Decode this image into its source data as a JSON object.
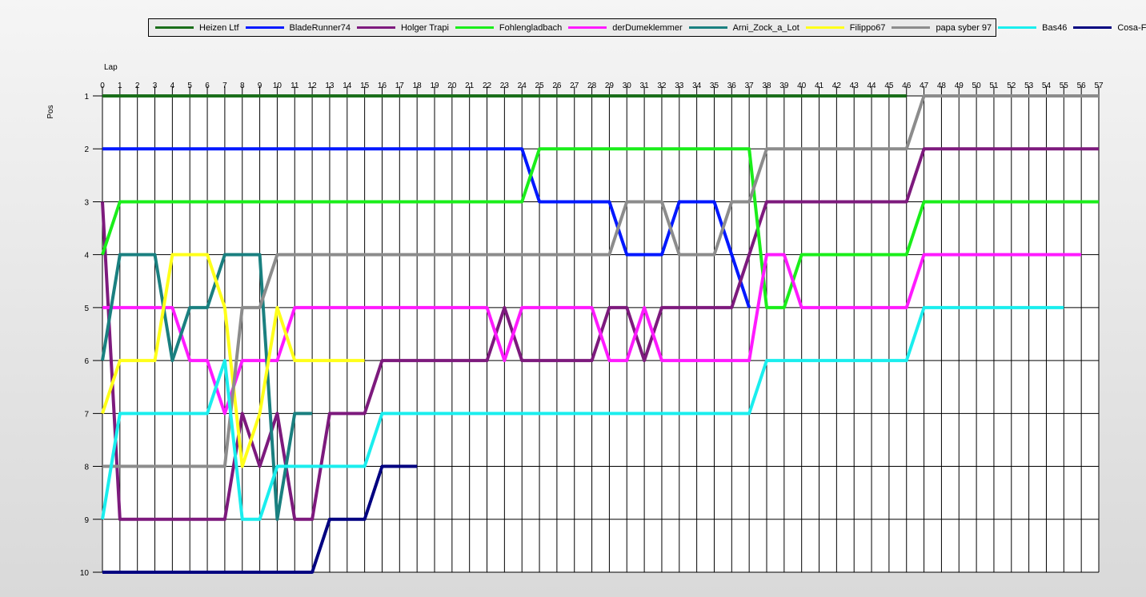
{
  "chart_data": {
    "type": "line",
    "xlabel": "Lap",
    "ylabel": "Pos",
    "xlim": [
      0,
      57
    ],
    "ylim": [
      1,
      10
    ],
    "y_inverted": true,
    "grid": true,
    "legend_position": "top",
    "x_ticks": [
      "0",
      "1",
      "2",
      "3",
      "4",
      "5",
      "6",
      "7",
      "8",
      "9",
      "10",
      "11",
      "12",
      "13",
      "14",
      "15",
      "16",
      "17",
      "18",
      "19",
      "20",
      "21",
      "22",
      "23",
      "24",
      "25",
      "26",
      "27",
      "28",
      "29",
      "30",
      "31",
      "32",
      "33",
      "34",
      "35",
      "36",
      "37",
      "38",
      "39",
      "40",
      "41",
      "42",
      "43",
      "44",
      "45",
      "46",
      "47",
      "48",
      "49",
      "50",
      "51",
      "52",
      "53",
      "54",
      "55",
      "56",
      "57"
    ],
    "y_ticks": [
      "1",
      "2",
      "3",
      "4",
      "5",
      "6",
      "7",
      "8",
      "9",
      "10"
    ],
    "series": [
      {
        "name": "Heizen Ltf",
        "color": "#1a6e1a",
        "points": [
          [
            0,
            1
          ],
          [
            46,
            1
          ]
        ]
      },
      {
        "name": "BladeRunner74",
        "color": "#0018ff",
        "points": [
          [
            0,
            2
          ],
          [
            24,
            2
          ],
          [
            25,
            3
          ],
          [
            29,
            3
          ],
          [
            30,
            4
          ],
          [
            32,
            4
          ],
          [
            33,
            3
          ],
          [
            35,
            3
          ],
          [
            37,
            5
          ]
        ]
      },
      {
        "name": "Holger Trapi",
        "color": "#7d1a7d",
        "points": [
          [
            0,
            3
          ],
          [
            1,
            9
          ],
          [
            7,
            9
          ],
          [
            8,
            7
          ],
          [
            9,
            8
          ],
          [
            10,
            7
          ],
          [
            11,
            9
          ],
          [
            12,
            9
          ],
          [
            13,
            7
          ],
          [
            15,
            7
          ],
          [
            16,
            6
          ],
          [
            22,
            6
          ],
          [
            23,
            5
          ],
          [
            24,
            6
          ],
          [
            28,
            6
          ],
          [
            29,
            5
          ],
          [
            30,
            5
          ],
          [
            31,
            6
          ],
          [
            32,
            5
          ],
          [
            36,
            5
          ],
          [
            38,
            3
          ],
          [
            46,
            3
          ],
          [
            47,
            2
          ],
          [
            57,
            2
          ]
        ]
      },
      {
        "name": "Fohlengladbach",
        "color": "#1aee1a",
        "points": [
          [
            0,
            4
          ],
          [
            1,
            3
          ],
          [
            24,
            3
          ],
          [
            25,
            2
          ],
          [
            37,
            2
          ],
          [
            38,
            5
          ],
          [
            39,
            5
          ],
          [
            40,
            4
          ],
          [
            46,
            4
          ],
          [
            47,
            3
          ],
          [
            57,
            3
          ]
        ]
      },
      {
        "name": "derDumeklemmer",
        "color": "#ff1aff",
        "points": [
          [
            0,
            5
          ],
          [
            4,
            5
          ],
          [
            5,
            6
          ],
          [
            6,
            6
          ],
          [
            7,
            7
          ],
          [
            8,
            6
          ],
          [
            10,
            6
          ],
          [
            11,
            5
          ],
          [
            22,
            5
          ],
          [
            23,
            6
          ],
          [
            24,
            5
          ],
          [
            28,
            5
          ],
          [
            29,
            6
          ],
          [
            30,
            6
          ],
          [
            31,
            5
          ],
          [
            32,
            6
          ],
          [
            37,
            6
          ],
          [
            38,
            4
          ],
          [
            39,
            4
          ],
          [
            40,
            5
          ],
          [
            46,
            5
          ],
          [
            47,
            4
          ],
          [
            56,
            4
          ]
        ]
      },
      {
        "name": "Arni_Zock_a_Lot",
        "color": "#1a8080",
        "points": [
          [
            0,
            6
          ],
          [
            1,
            4
          ],
          [
            3,
            4
          ],
          [
            4,
            6
          ],
          [
            5,
            5
          ],
          [
            6,
            5
          ],
          [
            7,
            4
          ],
          [
            9,
            4
          ],
          [
            10,
            9
          ],
          [
            11,
            7
          ],
          [
            12,
            7
          ]
        ]
      },
      {
        "name": "Filippo67",
        "color": "#ffff1a",
        "points": [
          [
            0,
            7
          ],
          [
            1,
            6
          ],
          [
            3,
            6
          ],
          [
            4,
            4
          ],
          [
            6,
            4
          ],
          [
            7,
            5
          ],
          [
            8,
            8
          ],
          [
            9,
            7
          ],
          [
            10,
            5
          ],
          [
            11,
            6
          ],
          [
            15,
            6
          ]
        ]
      },
      {
        "name": "papa syber 97",
        "color": "#8c8c8c",
        "points": [
          [
            0,
            8
          ],
          [
            7,
            8
          ],
          [
            8,
            5
          ],
          [
            9,
            5
          ],
          [
            10,
            4
          ],
          [
            29,
            4
          ],
          [
            30,
            3
          ],
          [
            32,
            3
          ],
          [
            33,
            4
          ],
          [
            35,
            4
          ],
          [
            36,
            3
          ],
          [
            37,
            3
          ],
          [
            38,
            2
          ],
          [
            46,
            2
          ],
          [
            47,
            1
          ],
          [
            57,
            1
          ]
        ]
      },
      {
        "name": "Bas46",
        "color": "#1aeeee",
        "points": [
          [
            0,
            9
          ],
          [
            1,
            7
          ],
          [
            6,
            7
          ],
          [
            7,
            6
          ],
          [
            8,
            9
          ],
          [
            9,
            9
          ],
          [
            10,
            8
          ],
          [
            15,
            8
          ],
          [
            16,
            7
          ],
          [
            37,
            7
          ],
          [
            38,
            6
          ],
          [
            46,
            6
          ],
          [
            47,
            5
          ],
          [
            55,
            5
          ]
        ]
      },
      {
        "name": "Cosa-Firefly",
        "color": "#000080",
        "points": [
          [
            0,
            10
          ],
          [
            12,
            10
          ],
          [
            13,
            9
          ],
          [
            15,
            9
          ],
          [
            16,
            8
          ],
          [
            18,
            8
          ]
        ]
      }
    ]
  }
}
